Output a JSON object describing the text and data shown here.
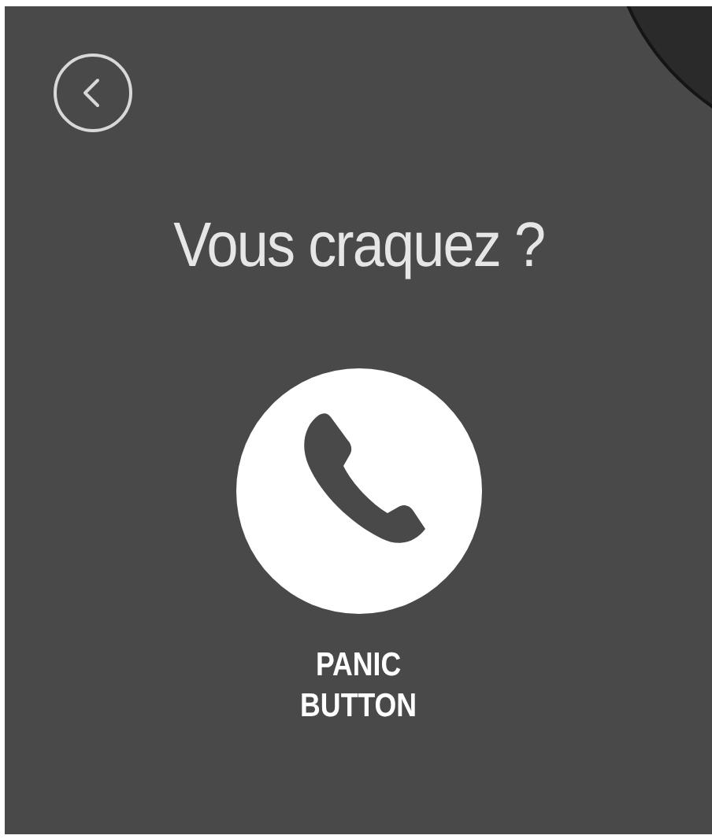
{
  "title": "Vous craquez ?",
  "panic_button": {
    "label_lines": [
      "PANIC",
      "BUTTON"
    ]
  }
}
